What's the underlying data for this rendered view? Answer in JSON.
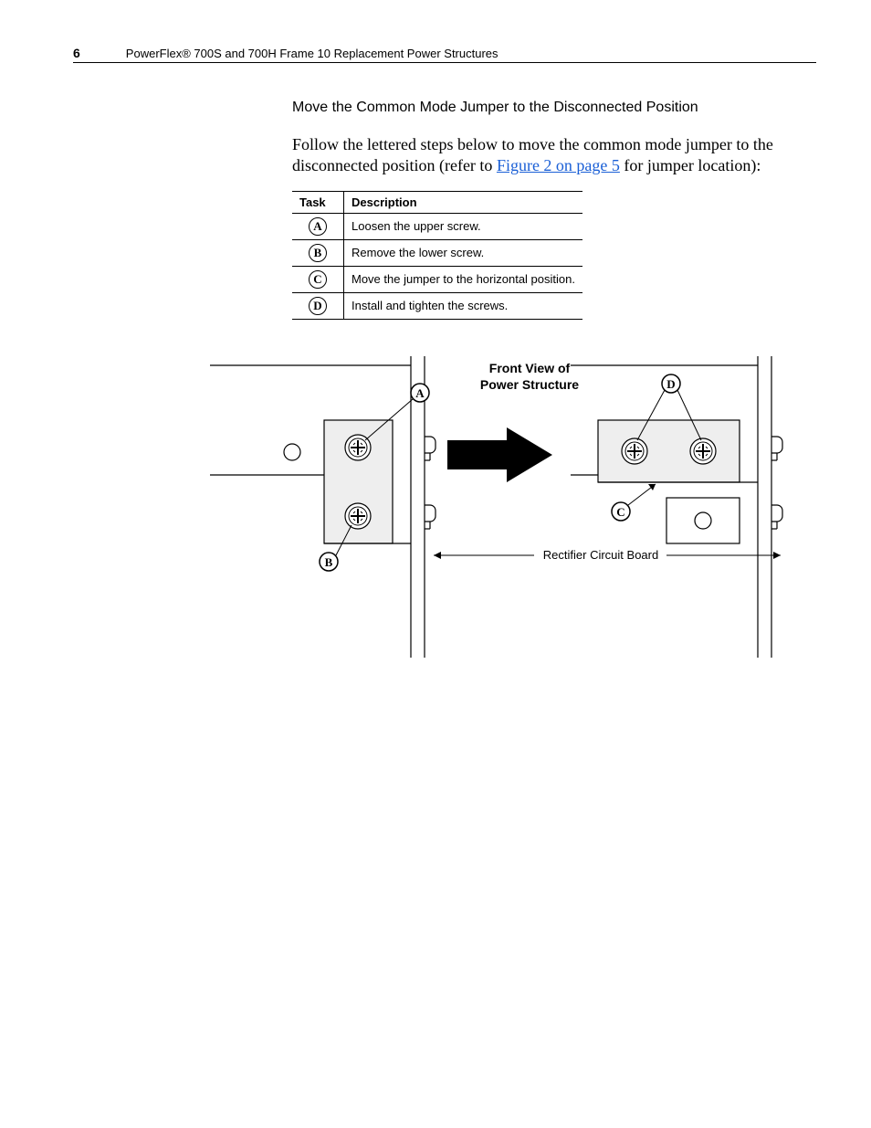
{
  "header": {
    "page_number": "6",
    "doc_title": "PowerFlex® 700S and 700H Frame 10 Replacement Power Structures"
  },
  "section": {
    "title": "Move the Common Mode Jumper to the Disconnected Position",
    "intro_pre": "Follow the lettered steps below to move the common mode jumper to the disconnected position (refer to ",
    "link_text": "Figure 2 on page 5",
    "intro_post": " for jumper location):"
  },
  "table": {
    "head_task": "Task",
    "head_desc": "Description",
    "rows": [
      {
        "letter": "A",
        "desc": "Loosen the upper screw."
      },
      {
        "letter": "B",
        "desc": "Remove the lower screw."
      },
      {
        "letter": "C",
        "desc": "Move the jumper to the horizontal position."
      },
      {
        "letter": "D",
        "desc": "Install and tighten the screws."
      }
    ]
  },
  "diagram": {
    "title_line1": "Front View of",
    "title_line2": "Power Structure",
    "label_rcb": "Rectifier Circuit Board",
    "callout_A": "A",
    "callout_B": "B",
    "callout_C": "C",
    "callout_D": "D"
  }
}
